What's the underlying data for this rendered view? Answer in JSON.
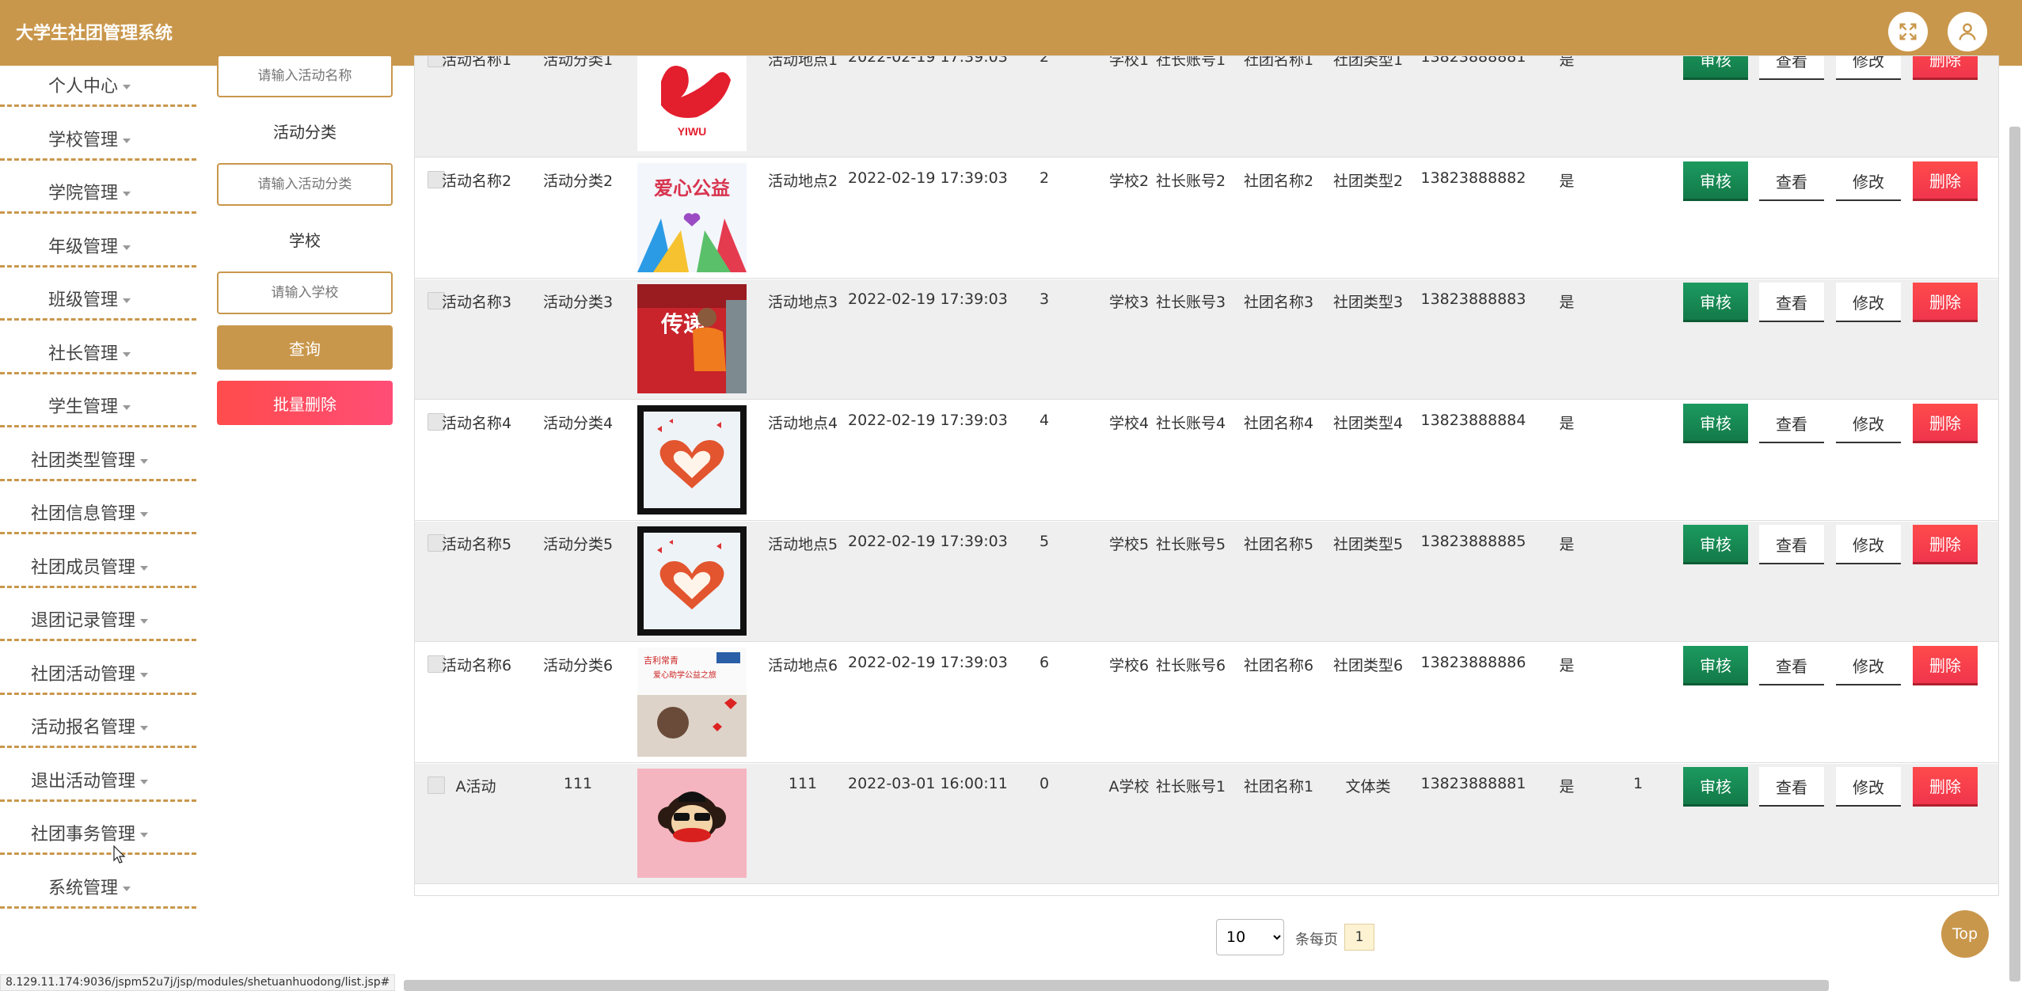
{
  "header": {
    "title": "大学生社团管理系统"
  },
  "sidebar": {
    "items": [
      {
        "label": "个人中心"
      },
      {
        "label": "学校管理"
      },
      {
        "label": "学院管理"
      },
      {
        "label": "年级管理"
      },
      {
        "label": "班级管理"
      },
      {
        "label": "社长管理"
      },
      {
        "label": "学生管理"
      },
      {
        "label": "社团类型管理"
      },
      {
        "label": "社团信息管理"
      },
      {
        "label": "社团成员管理"
      },
      {
        "label": "退团记录管理"
      },
      {
        "label": "社团活动管理"
      },
      {
        "label": "活动报名管理"
      },
      {
        "label": "退出活动管理"
      },
      {
        "label": "社团事务管理"
      },
      {
        "label": "系统管理"
      }
    ]
  },
  "filter": {
    "name_placeholder": "请输入活动名称",
    "category_label": "活动分类",
    "category_placeholder": "请输入活动分类",
    "school_label": "学校",
    "school_placeholder": "请输入学校",
    "query_label": "查询",
    "batch_delete_label": "批量删除"
  },
  "actions": {
    "audit": "审核",
    "view": "查看",
    "edit": "修改",
    "delete": "删除"
  },
  "rows": [
    {
      "name": "活动名称1",
      "category": "活动分类1",
      "image": "yiwu-logo",
      "place": "活动地点1",
      "time": "2022-02-19 17:39:03",
      "count": "2",
      "school": "学校1",
      "leader": "社长账号1",
      "club": "社团名称1",
      "type": "社团类型1",
      "phone": "13823888881",
      "flag": "是",
      "extra": ""
    },
    {
      "name": "活动名称2",
      "category": "活动分类2",
      "image": "charity-poster",
      "place": "活动地点2",
      "time": "2022-02-19 17:39:03",
      "count": "2",
      "school": "学校2",
      "leader": "社长账号2",
      "club": "社团名称2",
      "type": "社团类型2",
      "phone": "13823888882",
      "flag": "是",
      "extra": ""
    },
    {
      "name": "活动名称3",
      "category": "活动分类3",
      "image": "volunteer-photo",
      "place": "活动地点3",
      "time": "2022-02-19 17:39:03",
      "count": "3",
      "school": "学校3",
      "leader": "社长账号3",
      "club": "社团名称3",
      "type": "社团类型3",
      "phone": "13823888883",
      "flag": "是",
      "extra": ""
    },
    {
      "name": "活动名称4",
      "category": "活动分类4",
      "image": "heart-hands",
      "place": "活动地点4",
      "time": "2022-02-19 17:39:03",
      "count": "4",
      "school": "学校4",
      "leader": "社长账号4",
      "club": "社团名称4",
      "type": "社团类型4",
      "phone": "13823888884",
      "flag": "是",
      "extra": ""
    },
    {
      "name": "活动名称5",
      "category": "活动分类5",
      "image": "heart-hands",
      "place": "活动地点5",
      "time": "2022-02-19 17:39:03",
      "count": "5",
      "school": "学校5",
      "leader": "社长账号5",
      "club": "社团名称5",
      "type": "社团类型5",
      "phone": "13823888885",
      "flag": "是",
      "extra": ""
    },
    {
      "name": "活动名称6",
      "category": "活动分类6",
      "image": "poster-child",
      "place": "活动地点6",
      "time": "2022-02-19 17:39:03",
      "count": "6",
      "school": "学校6",
      "leader": "社长账号6",
      "club": "社团名称6",
      "type": "社团类型6",
      "phone": "13823888886",
      "flag": "是",
      "extra": ""
    },
    {
      "name": "A活动",
      "category": "111",
      "image": "monkey-cartoon",
      "place": "111",
      "time": "2022-03-01 16:00:11",
      "count": "0",
      "school": "A学校",
      "leader": "社长账号1",
      "club": "社团名称1",
      "type": "文体类",
      "phone": "13823888881",
      "flag": "是",
      "extra": "1"
    }
  ],
  "pagination": {
    "page_size": "10",
    "per_page_label": "条每页",
    "current_page": "1"
  },
  "top_button": "Top",
  "status_url": "8.129.11.174:9036/jspm52u7j/jsp/modules/shetuanhuodong/list.jsp#",
  "colors": {
    "primary": "#c9974c",
    "audit": "#1c9a60",
    "delete": "#ff4b4b"
  }
}
